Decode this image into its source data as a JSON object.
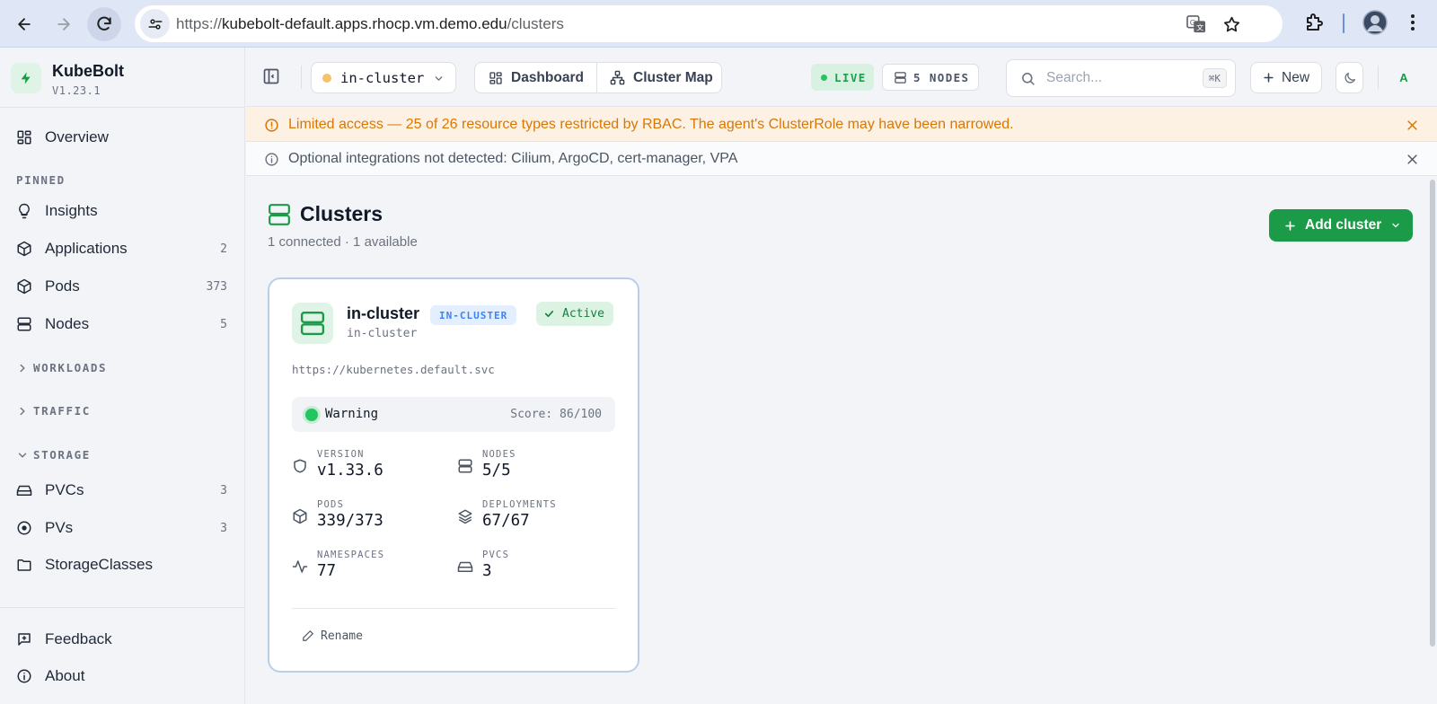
{
  "browser": {
    "url_prefix": "https://",
    "url_host": "kubebolt-default.apps.rhocp.vm.demo.edu",
    "url_path": "/clusters"
  },
  "brand": {
    "name": "KubeBolt",
    "version": "V1.23.1"
  },
  "sidebar": {
    "overview": "Overview",
    "pinned_label": "PINNED",
    "pinned": [
      {
        "label": "Insights",
        "count": "",
        "icon": "lightbulb-icon"
      },
      {
        "label": "Applications",
        "count": "2",
        "icon": "cube-icon"
      },
      {
        "label": "Pods",
        "count": "373",
        "icon": "cube-icon"
      },
      {
        "label": "Nodes",
        "count": "5",
        "icon": "server-icon"
      }
    ],
    "sections": {
      "workloads": "WORKLOADS",
      "traffic": "TRAFFIC",
      "storage": "STORAGE"
    },
    "storage_items": [
      {
        "label": "PVCs",
        "count": "3",
        "icon": "drive-icon"
      },
      {
        "label": "PVs",
        "count": "3",
        "icon": "disc-icon"
      },
      {
        "label": "StorageClasses",
        "count": "",
        "icon": "folder-icon"
      }
    ],
    "feedback": "Feedback",
    "about": "About"
  },
  "topbar": {
    "cluster": "in-cluster",
    "dashboard": "Dashboard",
    "cluster_map": "Cluster Map",
    "live": "LIVE",
    "nodes": "5 NODES",
    "search_placeholder": "Search...",
    "search_shortcut": "⌘K",
    "new": "New",
    "avatar": "A"
  },
  "banners": {
    "warning": "Limited access — 25 of 26 resource types restricted by RBAC. The agent's ClusterRole may have been narrowed.",
    "info": "Optional integrations not detected: Cilium, ArgoCD, cert-manager, VPA"
  },
  "page": {
    "title": "Clusters",
    "subtitle": "1 connected · 1 available",
    "add_button": "Add cluster"
  },
  "card": {
    "name": "in-cluster",
    "badge": "IN-CLUSTER",
    "context": "in-cluster",
    "status": "Active",
    "url": "https://kubernetes.default.svc",
    "health_label": "Warning",
    "health_score": "Score: 86/100",
    "stats": {
      "version_label": "VERSION",
      "version": "v1.33.6",
      "nodes_label": "NODES",
      "nodes": "5/5",
      "pods_label": "PODS",
      "pods": "339/373",
      "deployments_label": "DEPLOYMENTS",
      "deployments": "67/67",
      "namespaces_label": "NAMESPACES",
      "namespaces": "77",
      "pvcs_label": "PVCS",
      "pvcs": "3"
    },
    "rename": "Rename"
  },
  "colors": {
    "accent_green": "#1b9a47",
    "warning_text": "#d97706",
    "badge_blue": "#3b82f6",
    "healthy_dot": "#22c55e"
  }
}
